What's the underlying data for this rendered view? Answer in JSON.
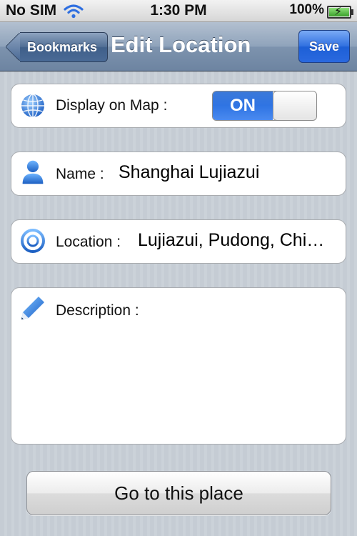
{
  "status_bar": {
    "carrier": "No SIM",
    "time": "1:30 PM",
    "battery": "100%",
    "wifi_icon": "wifi-icon",
    "battery_icon": "battery-charging-icon"
  },
  "nav_bar": {
    "back_label": "Bookmarks",
    "title": "Edit Location",
    "save_label": "Save"
  },
  "display_on_map": {
    "label": "Display on Map :",
    "switch_text": "ON",
    "switch_state": true,
    "icon": "globe-icon"
  },
  "name": {
    "label": "Name :",
    "value": "Shanghai Lujiazui",
    "icon": "person-icon"
  },
  "location": {
    "label": "Location :",
    "value": "Lujiazui, Pudong, Chi…",
    "icon": "target-icon"
  },
  "description": {
    "label": "Description :",
    "value": "",
    "icon": "pencil-icon"
  },
  "go_button": {
    "label": "Go to this place"
  },
  "colors": {
    "accent_blue": "#2f74e3",
    "nav_bar": "#8fa3bb",
    "background": "#c5ccd4"
  }
}
